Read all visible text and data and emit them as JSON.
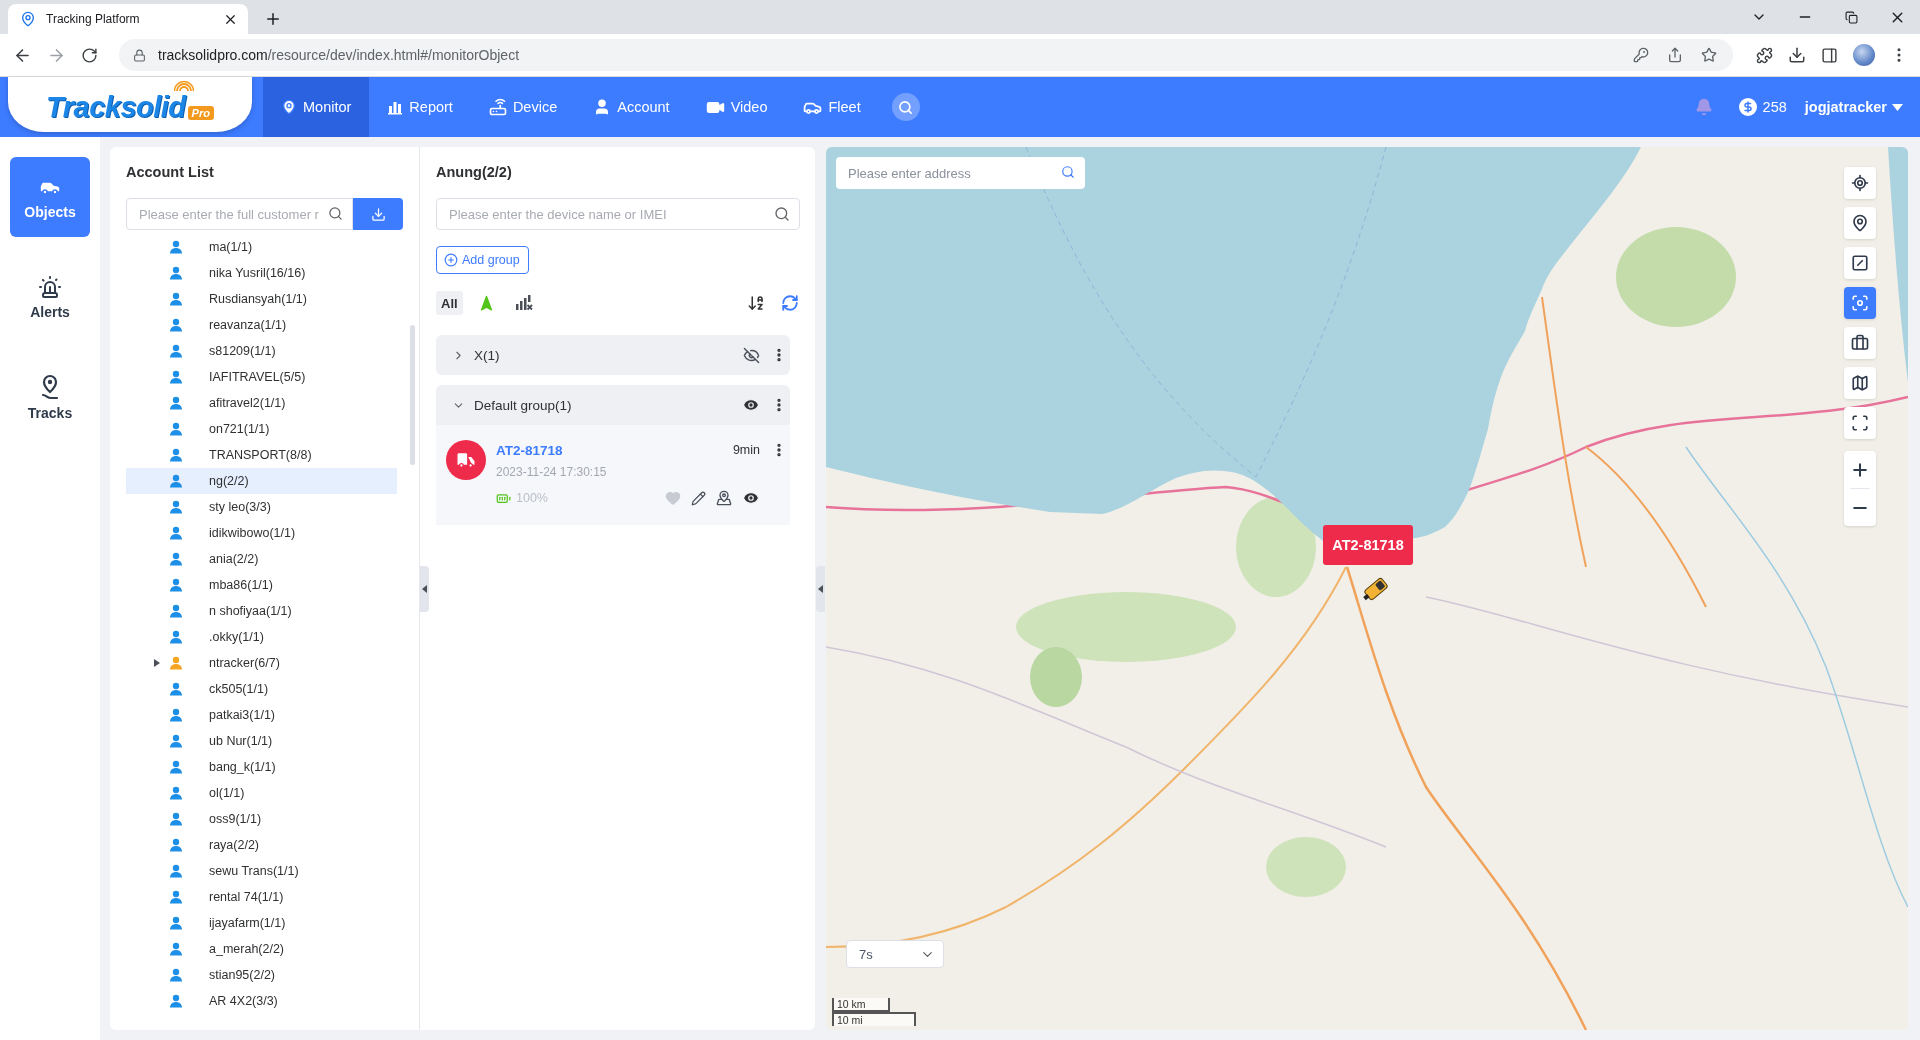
{
  "browser": {
    "tab_title": "Tracking Platform",
    "url_host": "tracksolidpro.com",
    "url_path": "/resource/dev/index.html#/monitorObject"
  },
  "header": {
    "logo": {
      "name": "Tracksolid",
      "badge": "Pro"
    },
    "nav": [
      {
        "kind": "monitor",
        "label": "Monitor",
        "selected": true
      },
      {
        "kind": "report",
        "label": "Report",
        "selected": false
      },
      {
        "kind": "device",
        "label": "Device",
        "selected": false
      },
      {
        "kind": "account",
        "label": "Account",
        "selected": false
      },
      {
        "kind": "video",
        "label": "Video",
        "selected": false
      },
      {
        "kind": "fleet",
        "label": "Fleet",
        "selected": false
      }
    ],
    "balance": "258",
    "user": "jogjatracker"
  },
  "sidebar": {
    "items": [
      {
        "kind": "objects",
        "label": "Objects",
        "selected": true
      },
      {
        "kind": "alerts",
        "label": "Alerts",
        "selected": false
      },
      {
        "kind": "tracks",
        "label": "Tracks",
        "selected": false
      }
    ]
  },
  "account_list": {
    "title": "Account List",
    "search": {
      "placeholder": "Please enter the full customer r"
    },
    "rows": [
      {
        "kind": "user",
        "label": "ma(1/1)",
        "selected": false
      },
      {
        "kind": "user",
        "label": "nika Yusril(16/16)",
        "selected": false
      },
      {
        "kind": "user",
        "label": "Rusdiansyah(1/1)",
        "selected": false
      },
      {
        "kind": "user",
        "label": "reavanza(1/1)",
        "selected": false
      },
      {
        "kind": "user",
        "label": "s81209(1/1)",
        "selected": false
      },
      {
        "kind": "user",
        "label": "IAFITRAVEL(5/5)",
        "selected": false
      },
      {
        "kind": "user",
        "label": "afitravel2(1/1)",
        "selected": false
      },
      {
        "kind": "user",
        "label": "on721(1/1)",
        "selected": false
      },
      {
        "kind": "user",
        "label": "TRANSPORT(8/8)",
        "selected": false
      },
      {
        "kind": "user",
        "label": "ng(2/2)",
        "selected": true
      },
      {
        "kind": "user",
        "label": "sty leo(3/3)",
        "selected": false
      },
      {
        "kind": "user",
        "label": "idikwibowo(1/1)",
        "selected": false
      },
      {
        "kind": "user",
        "label": "ania(2/2)",
        "selected": false
      },
      {
        "kind": "user",
        "label": "mba86(1/1)",
        "selected": false
      },
      {
        "kind": "user",
        "label": "n shofiyaa(1/1)",
        "selected": false
      },
      {
        "kind": "user",
        "label": ".okky(1/1)",
        "selected": false
      },
      {
        "kind": "parent",
        "label": "ntracker(6/7)",
        "selected": false,
        "expanded": false
      },
      {
        "kind": "user",
        "label": "ck505(1/1)",
        "selected": false
      },
      {
        "kind": "user",
        "label": "patkai3(1/1)",
        "selected": false
      },
      {
        "kind": "user",
        "label": "ub Nur(1/1)",
        "selected": false
      },
      {
        "kind": "user",
        "label": "bang_k(1/1)",
        "selected": false
      },
      {
        "kind": "user",
        "label": "ol(1/1)",
        "selected": false
      },
      {
        "kind": "user",
        "label": "oss9(1/1)",
        "selected": false
      },
      {
        "kind": "user",
        "label": "raya(2/2)",
        "selected": false
      },
      {
        "kind": "user",
        "label": "sewu Trans(1/1)",
        "selected": false
      },
      {
        "kind": "user",
        "label": "rental 74(1/1)",
        "selected": false
      },
      {
        "kind": "user",
        "label": "ijayafarm(1/1)",
        "selected": false
      },
      {
        "kind": "user",
        "label": "a_merah(2/2)",
        "selected": false
      },
      {
        "kind": "user",
        "label": "stian95(2/2)",
        "selected": false
      },
      {
        "kind": "user",
        "label": "AR 4X2(3/3)",
        "selected": false
      }
    ]
  },
  "device_panel": {
    "title": "Anung(2/2)",
    "search": {
      "placeholder": "Please enter the device name or IMEI"
    },
    "add_group": "Add group",
    "filters": [
      {
        "kind": "all",
        "label": "All",
        "selected": true
      },
      {
        "kind": "moving",
        "selected": false
      },
      {
        "kind": "offline",
        "selected": false
      }
    ],
    "groups": [
      {
        "name": "X(1)",
        "expanded": false,
        "visible": false
      },
      {
        "name": "Default group(1)",
        "expanded": true,
        "visible": true,
        "devices": [
          {
            "name": "AT2-81718",
            "age": "9min",
            "time": "2023-11-24 17:30:15",
            "battery": "100%",
            "favorite": false
          }
        ]
      }
    ]
  },
  "map": {
    "address_search": {
      "placeholder": "Please enter address"
    },
    "marker": {
      "label": "AT2-81718"
    },
    "tools": [
      {
        "kind": "locate",
        "selected": false
      },
      {
        "kind": "pin",
        "selected": false
      },
      {
        "kind": "measure",
        "selected": false
      },
      {
        "kind": "focus",
        "selected": true
      },
      {
        "kind": "toolbox",
        "selected": false
      },
      {
        "kind": "layers",
        "selected": false
      },
      {
        "kind": "fullscreen",
        "selected": false
      }
    ],
    "refresh": {
      "value": "7s"
    },
    "scale": {
      "metric": "10 km",
      "imperial": "10 mi"
    }
  }
}
